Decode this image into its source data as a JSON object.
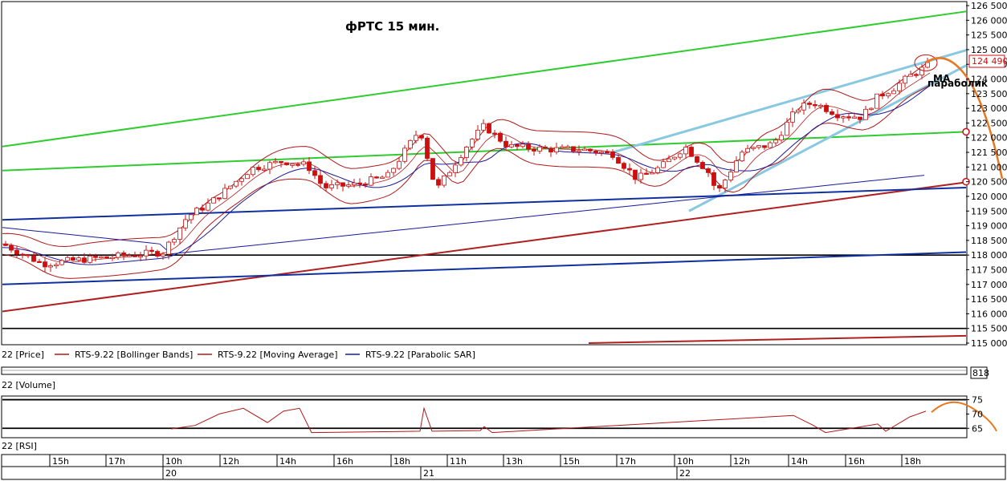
{
  "chart_data": {
    "type": "candlestick",
    "title": "фРТС    15 мин.",
    "annotations": [
      "МА",
      "параболик"
    ],
    "last_price_label": "124 490",
    "price_axis_ticks": [
      "126 500",
      "126 000",
      "125 500",
      "125 000",
      "124 500",
      "124 000",
      "123 500",
      "123 000",
      "122 500",
      "122 000",
      "121 500",
      "121 000",
      "120 500",
      "120 000",
      "119 500",
      "119 000",
      "118 500",
      "118 000",
      "117 500",
      "117 000",
      "116 500",
      "116 000",
      "115 500",
      "115 000"
    ],
    "ylim": [
      115000,
      126500
    ],
    "legend": [
      {
        "label": "22 [Price]",
        "color": "#000000"
      },
      {
        "label": "RTS-9.22 [Bollinger Bands]",
        "color": "#b01818"
      },
      {
        "label": "RTS-9.22 [Moving Average]",
        "color": "#b01818"
      },
      {
        "label": "RTS-9.22 [Parabolic SAR]",
        "color": "#1a1a9c"
      }
    ],
    "volume_panel": {
      "label": "22 [Volume]",
      "value_label": "818"
    },
    "rsi_panel": {
      "label": "22 [RSI]",
      "ticks": [
        "75",
        "70",
        "65"
      ],
      "levels": [
        75,
        65
      ],
      "ylim": [
        62,
        76
      ]
    },
    "time_axis": {
      "hours": [
        "15h",
        "17h",
        "10h",
        "12h",
        "14h",
        "16h",
        "18h",
        "11h",
        "13h",
        "15h",
        "17h",
        "10h",
        "12h",
        "14h",
        "16h",
        "18h"
      ],
      "dates": [
        "20",
        "21",
        "22"
      ]
    },
    "colors": {
      "bull": "#ffffff",
      "bear": "#cc1010",
      "candle_outline": "#cc1010",
      "bollinger": "#b01818",
      "moving_average": "#1a1a9c",
      "parabolic_sar": "#1a1a9c",
      "trend_green": "#2ecc2e",
      "channel_lightblue": "#88c8e0",
      "trend_red": "#b02020",
      "trend_blue": "#1030a0",
      "forecast_orange": "#e87820"
    },
    "series": [
      {
        "name": "Price",
        "points": [
          [
            0,
            118380
          ],
          [
            50,
            117700
          ],
          [
            100,
            117850
          ],
          [
            200,
            118100
          ],
          [
            230,
            119300
          ],
          [
            260,
            119800
          ],
          [
            310,
            120950
          ],
          [
            350,
            121200
          ],
          [
            380,
            121050
          ],
          [
            400,
            120300
          ],
          [
            440,
            120400
          ],
          [
            480,
            120700
          ],
          [
            520,
            122300
          ],
          [
            540,
            120200
          ],
          [
            580,
            121800
          ],
          [
            600,
            122400
          ],
          [
            630,
            121700
          ],
          [
            680,
            121600
          ],
          [
            720,
            121600
          ],
          [
            760,
            121450
          ],
          [
            790,
            120600
          ],
          [
            820,
            121000
          ],
          [
            850,
            121700
          ],
          [
            880,
            120800
          ],
          [
            890,
            120100
          ],
          [
            920,
            121500
          ],
          [
            960,
            121800
          ],
          [
            990,
            123000
          ],
          [
            1010,
            123200
          ],
          [
            1040,
            122800
          ],
          [
            1070,
            122700
          ],
          [
            1090,
            123400
          ],
          [
            1110,
            123700
          ],
          [
            1130,
            124100
          ],
          [
            1155,
            124490
          ]
        ]
      }
    ],
    "x_domain": [
      0,
      1200
    ],
    "trendlines": [
      {
        "color": "green",
        "from": [
          0,
          121700
        ],
        "to": [
          1200,
          126300
        ]
      },
      {
        "color": "green",
        "from": [
          0,
          120880
        ],
        "to": [
          1200,
          122200
        ]
      },
      {
        "color": "lightblue",
        "from": [
          855,
          119500
        ],
        "to": [
          1200,
          124460
        ]
      },
      {
        "color": "lightblue",
        "from": [
          760,
          121500
        ],
        "to": [
          1200,
          124980
        ]
      },
      {
        "color": "darkred",
        "from": [
          0,
          116080
        ],
        "to": [
          1200,
          120480
        ]
      },
      {
        "color": "darkred",
        "from": [
          730,
          115000
        ],
        "to": [
          1200,
          115250
        ]
      },
      {
        "color": "blue",
        "from": [
          0,
          119200
        ],
        "to": [
          1200,
          120300
        ]
      },
      {
        "color": "blue",
        "from": [
          0,
          117000
        ],
        "to": [
          1200,
          118100
        ]
      }
    ],
    "horizontal_levels": [
      118000,
      115500
    ],
    "markers": [
      122200,
      120500
    ],
    "forecast": [
      [
        1150,
        124560
      ],
      [
        1175,
        124700
      ],
      [
        1200,
        124100
      ],
      [
        1220,
        122500
      ],
      [
        1245,
        120600
      ]
    ],
    "rsi_points": [
      [
        210,
        64.8
      ],
      [
        240,
        66
      ],
      [
        270,
        70
      ],
      [
        300,
        72
      ],
      [
        330,
        67
      ],
      [
        350,
        71
      ],
      [
        370,
        72
      ],
      [
        385,
        63.5
      ],
      [
        520,
        64
      ],
      [
        525,
        72
      ],
      [
        535,
        64
      ],
      [
        595,
        64.2
      ],
      [
        600,
        65.6
      ],
      [
        610,
        63.5
      ],
      [
        985,
        69.5
      ],
      [
        1010,
        66
      ],
      [
        1025,
        63.5
      ],
      [
        1090,
        66.5
      ],
      [
        1100,
        64
      ],
      [
        1130,
        69
      ],
      [
        1150,
        71
      ]
    ],
    "rsi_forecast": [
      [
        1157,
        70.6
      ],
      [
        1180,
        74.8
      ],
      [
        1205,
        72.5
      ],
      [
        1238,
        64
      ]
    ]
  }
}
